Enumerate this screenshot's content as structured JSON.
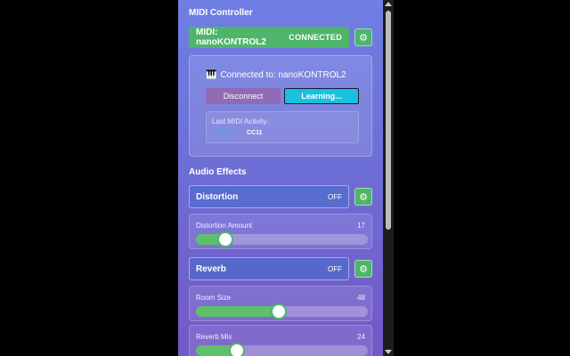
{
  "midi": {
    "section_title": "MIDI Controller",
    "device_label": "MIDI: nanoKONTROL2",
    "status": "CONNECTED",
    "connected_icon": "🎹",
    "connected_text": "Connected to: nanoKONTROL2",
    "disconnect_label": "Disconnect",
    "learning_label": "Learning...",
    "activity_label": "Last MIDI Activity:",
    "activity_time": "10:42:15",
    "activity_cc": "CC11",
    "gear_icon": "⚙"
  },
  "effects": {
    "section_title": "Audio Effects",
    "distortion": {
      "name": "Distortion",
      "state": "OFF",
      "amount_label": "Distortion Amount",
      "amount_value": "17",
      "amount_fraction": 0.17
    },
    "reverb": {
      "name": "Reverb",
      "state": "OFF",
      "room_label": "Room Size",
      "room_value": "48",
      "room_fraction": 0.48,
      "mix_label": "Reverb Mix",
      "mix_value": "24",
      "mix_fraction": 0.24
    },
    "gear_icon": "⚙"
  },
  "colors": {
    "accent_green": "#4fb56a",
    "learning_cyan": "#17c1e0",
    "disconnect_purple": "#8e6bb3"
  }
}
